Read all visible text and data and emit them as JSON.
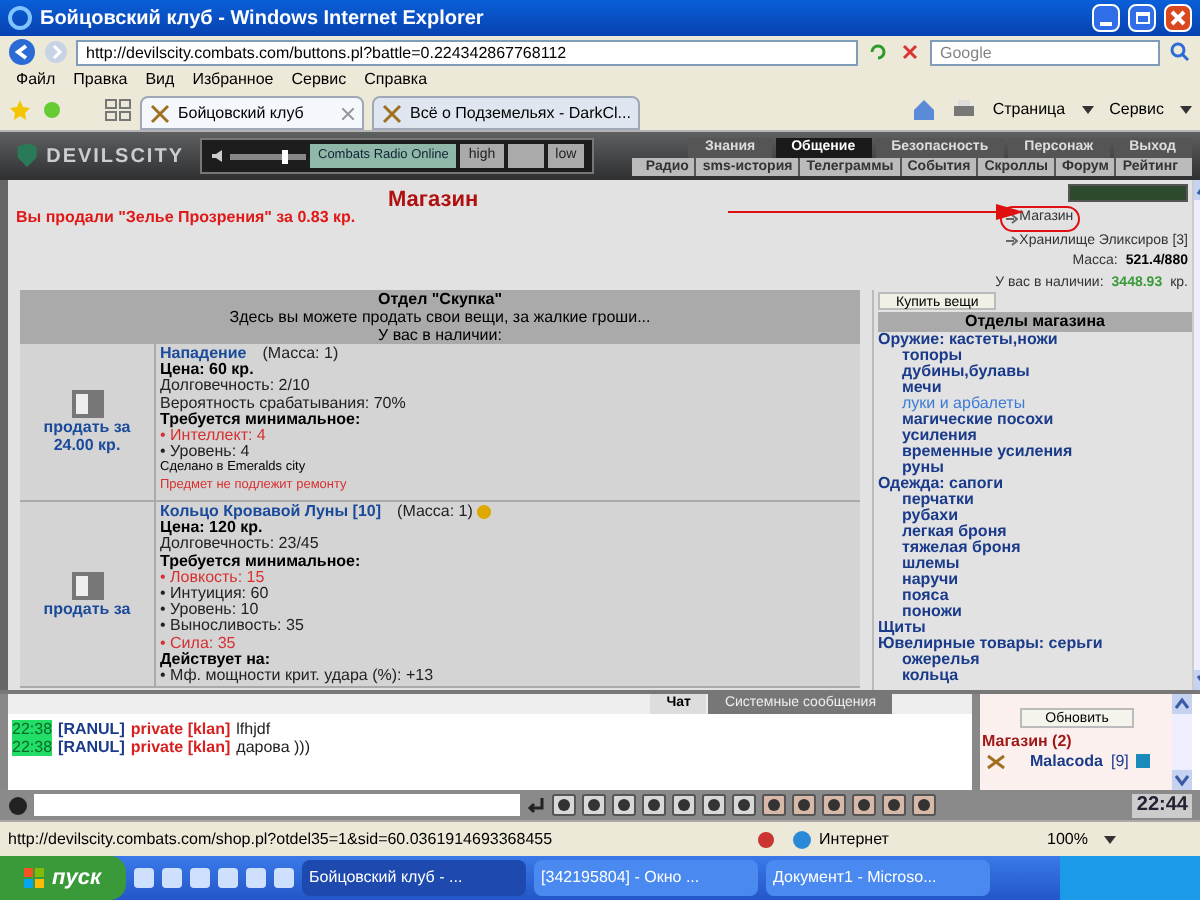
{
  "window": {
    "title": "Бойцовский клуб - Windows Internet Explorer"
  },
  "browser": {
    "address": "http://devilscity.combats.com/buttons.pl?battle=0.224342867768112",
    "search": {
      "placeholder": "Google"
    },
    "menu": [
      "Файл",
      "Правка",
      "Вид",
      "Избранное",
      "Сервис",
      "Справка"
    ],
    "tabs": [
      {
        "label": "Бойцовский клуб",
        "selected": true
      },
      {
        "label": "Всё о Подземельях - DarkCl...",
        "selected": false
      }
    ],
    "tools": [
      "Страница",
      "Сервис"
    ]
  },
  "game": {
    "logo": "DEVILSCITY",
    "radio": {
      "level": 0.75,
      "label": "Combats Radio Online",
      "buttons": [
        "high",
        "low"
      ]
    },
    "nav": [
      {
        "label": "Знания",
        "selected": false
      },
      {
        "label": "Общение",
        "selected": true
      },
      {
        "label": "Безопасность",
        "selected": false
      },
      {
        "label": "Персонаж",
        "selected": false
      },
      {
        "label": "Выход",
        "selected": false
      }
    ],
    "subnav": [
      "Радио",
      "sms-история",
      "Телеграммы",
      "События",
      "Скроллы",
      "Форум",
      "Рейтинг"
    ]
  },
  "shop": {
    "title": "Магазин",
    "message": "Вы продали \"Зелье Прозрения\" за 0.83 кр.",
    "links": [
      "Магазин",
      "Хранилище Эликсиров [3]"
    ],
    "mass_label": "Масса:",
    "mass": "521.4/880",
    "money_label": "У вас в наличии:",
    "money": "3448.93",
    "money_unit": "кр.",
    "section": {
      "title": "Отдел \"Скупка\"",
      "subtitle": "Здесь вы можете продать свои вещи, за жалкие гроши...",
      "note": "У вас в наличии:"
    },
    "items": [
      {
        "name": "Нападение",
        "mass": "(Масса: 1)",
        "sell": "продать за 24.00 кр.",
        "badge": false,
        "lines": [
          {
            "kind": "bold",
            "text": "Цена: 60 кр."
          },
          {
            "kind": "plain",
            "text": "Долговечность: 2/10"
          },
          {
            "kind": "plain",
            "text": "Вероятность срабатывания: 70%"
          },
          {
            "kind": "bold",
            "text": "Требуется минимальное:"
          },
          {
            "kind": "fail",
            "text": "• Интеллект: 4"
          },
          {
            "kind": "plain",
            "text": "• Уровень: 4"
          },
          {
            "kind": "small",
            "text": "Сделано в Emeralds city"
          },
          {
            "kind": "warning",
            "text": "Предмет не подлежит ремонту"
          }
        ]
      },
      {
        "name": "Кольцо Кровавой Луны [10]",
        "mass": "(Масса: 1)",
        "sell": "продать за",
        "badge": true,
        "lines": [
          {
            "kind": "bold",
            "text": "Цена: 120 кр."
          },
          {
            "kind": "plain",
            "text": "Долговечность: 23/45"
          },
          {
            "kind": "bold",
            "text": "Требуется минимальное:"
          },
          {
            "kind": "fail",
            "text": "• Ловкость: 15"
          },
          {
            "kind": "plain",
            "text": "• Интуиция: 60"
          },
          {
            "kind": "plain",
            "text": "• Уровень: 10"
          },
          {
            "kind": "plain",
            "text": "• Выносливость: 35"
          },
          {
            "kind": "fail",
            "text": "• Сила: 35"
          },
          {
            "kind": "bold",
            "text": "Действует на:"
          },
          {
            "kind": "plain",
            "text": "• Мф. мощности крит. удара (%): +13"
          }
        ]
      }
    ],
    "buy_button": "Купить вещи",
    "departments_title": "Отделы магазина",
    "departments": [
      {
        "label": "Оружие: кастеты,ножи",
        "selected": false,
        "children": [
          {
            "label": "топоры",
            "selected": false
          },
          {
            "label": "дубины,булавы",
            "selected": false
          },
          {
            "label": "мечи",
            "selected": false
          },
          {
            "label": "луки и арбалеты",
            "selected": true
          },
          {
            "label": "магические посохи",
            "selected": false
          },
          {
            "label": "усиления",
            "selected": false
          },
          {
            "label": "временные усиления",
            "selected": false
          },
          {
            "label": "руны",
            "selected": false
          }
        ]
      },
      {
        "label": "Одежда: сапоги",
        "selected": false,
        "children": [
          {
            "label": "перчатки",
            "selected": false
          },
          {
            "label": "рубахи",
            "selected": false
          },
          {
            "label": "легкая броня",
            "selected": false
          },
          {
            "label": "тяжелая броня",
            "selected": false
          },
          {
            "label": "шлемы",
            "selected": false
          },
          {
            "label": "наручи",
            "selected": false
          },
          {
            "label": "пояса",
            "selected": false
          },
          {
            "label": "поножи",
            "selected": false
          }
        ]
      },
      {
        "label": "Щиты",
        "selected": false
      },
      {
        "label": "Ювелирные товары: серьги",
        "selected": false,
        "children": [
          {
            "label": "ожерелья",
            "selected": false
          },
          {
            "label": "кольца",
            "selected": false
          }
        ]
      }
    ]
  },
  "chat": {
    "tabs": [
      {
        "label": "Чат",
        "selected": true
      },
      {
        "label": "Системные сообщения",
        "selected": false
      }
    ],
    "messages": [
      {
        "time": "22:38",
        "user": "[RANUL]",
        "channel": "private [klan]",
        "text": "lfhjdf"
      },
      {
        "time": "22:38",
        "user": "[RANUL]",
        "channel": "private [klan]",
        "text": "дарова )))"
      }
    ],
    "refresh_button": "Обновить",
    "room": "Магазин (2)",
    "users": [
      {
        "name": "Malacoda",
        "level": "[9]"
      }
    ],
    "clock": "22:44"
  },
  "status_bar": {
    "url": "http://devilscity.combats.com/shop.pl?otdel35=1&sid=60.0361914693368455",
    "zone": "Интернет",
    "zoom": "100%"
  },
  "taskbar": {
    "start": "пуск",
    "tasks": [
      {
        "label": "Бойцовский клуб - ...",
        "selected": true
      },
      {
        "label": "[342195804] - Окно ...",
        "selected": false
      },
      {
        "label": "Документ1 - Microso...",
        "selected": false
      }
    ]
  }
}
